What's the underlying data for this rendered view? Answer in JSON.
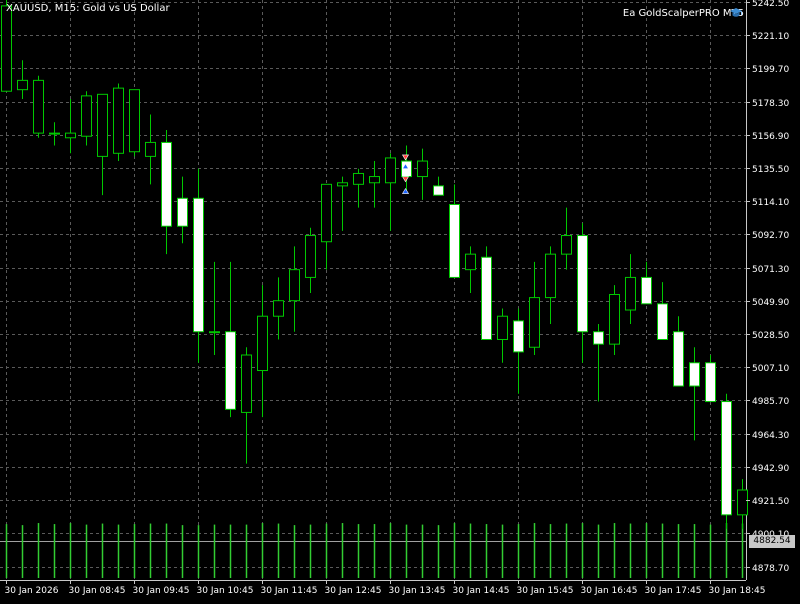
{
  "window": {
    "symbol_title": "XAUUSD, M15:  Gold vs US Dollar",
    "ea_name": "Ea GoldScalperPRO MT5",
    "ea_icon": "graduation-cap-icon"
  },
  "colors": {
    "background": "#000000",
    "grid": "#5a5a5a",
    "candle_outline": "#00c800",
    "bull_fill": "#000000",
    "bear_fill": "#ffffff",
    "volume": "#32cd32",
    "text": "#ffffff",
    "current_price_tag": "#c8c8c8"
  },
  "chart_data": {
    "type": "candlestick",
    "symbol": "XAUUSD",
    "timeframe": "M15",
    "y_ticks": [
      4878.7,
      4900.1,
      4921.5,
      4942.9,
      4964.3,
      4985.7,
      5007.1,
      5028.5,
      5049.9,
      5071.3,
      5092.7,
      5114.1,
      5135.5,
      5156.9,
      5178.3,
      5199.7,
      5221.1,
      5242.5
    ],
    "y_tick_labels": [
      "4878.70",
      "4900.10",
      "4921.50",
      "4942.90",
      "4964.30",
      "4985.70",
      "5007.10",
      "5028.50",
      "5049.90",
      "5071.30",
      "5092.70",
      "5114.10",
      "5135.50",
      "5156.90",
      "5178.30",
      "5199.70",
      "5221.10",
      "5242.50"
    ],
    "ylim": [
      4870,
      5242.5
    ],
    "x_tick_labels": [
      "30 Jan 2026",
      "30 Jan 08:45",
      "30 Jan 09:45",
      "30 Jan 10:45",
      "30 Jan 11:45",
      "30 Jan 12:45",
      "30 Jan 13:45",
      "30 Jan 14:45",
      "30 Jan 15:45",
      "30 Jan 16:45",
      "30 Jan 17:45",
      "30 Jan 18:45"
    ],
    "x_tick_every_n_bars": 4,
    "current_price": "4882.54",
    "grid": true,
    "candles": [
      {
        "o": 5185,
        "h": 5245,
        "l": 5185,
        "c": 5240
      },
      {
        "o": 5186,
        "h": 5205,
        "l": 5180,
        "c": 5192
      },
      {
        "o": 5158,
        "h": 5195,
        "l": 5155,
        "c": 5192
      },
      {
        "o": 5158,
        "h": 5165,
        "l": 5150,
        "c": 5158
      },
      {
        "o": 5155,
        "h": 5180,
        "l": 5145,
        "c": 5158
      },
      {
        "o": 5156,
        "h": 5185,
        "l": 5150,
        "c": 5182
      },
      {
        "o": 5143,
        "h": 5180,
        "l": 5118,
        "c": 5183
      },
      {
        "o": 5145,
        "h": 5190,
        "l": 5140,
        "c": 5187
      },
      {
        "o": 5146,
        "h": 5186,
        "l": 5143,
        "c": 5186
      },
      {
        "o": 5143,
        "h": 5170,
        "l": 5125,
        "c": 5152
      },
      {
        "o": 5152,
        "h": 5160,
        "l": 5080,
        "c": 5098
      },
      {
        "o": 5116,
        "h": 5130,
        "l": 5087,
        "c": 5098
      },
      {
        "o": 5116,
        "h": 5135,
        "l": 5010,
        "c": 5030
      },
      {
        "o": 5030,
        "h": 5075,
        "l": 5015,
        "c": 5030
      },
      {
        "o": 5030,
        "h": 5075,
        "l": 4975,
        "c": 4980
      },
      {
        "o": 4978,
        "h": 5020,
        "l": 4945,
        "c": 5015
      },
      {
        "o": 5005,
        "h": 5060,
        "l": 4975,
        "c": 5040
      },
      {
        "o": 5040,
        "h": 5065,
        "l": 5025,
        "c": 5050
      },
      {
        "o": 5050,
        "h": 5085,
        "l": 5030,
        "c": 5070
      },
      {
        "o": 5065,
        "h": 5097,
        "l": 5055,
        "c": 5092
      },
      {
        "o": 5088,
        "h": 5125,
        "l": 5070,
        "c": 5125
      },
      {
        "o": 5124,
        "h": 5130,
        "l": 5095,
        "c": 5126
      },
      {
        "o": 5125,
        "h": 5135,
        "l": 5110,
        "c": 5132
      },
      {
        "o": 5126,
        "h": 5140,
        "l": 5110,
        "c": 5130
      },
      {
        "o": 5126,
        "h": 5145,
        "l": 5095,
        "c": 5142
      },
      {
        "o": 5140,
        "h": 5150,
        "l": 5120,
        "c": 5130
      },
      {
        "o": 5130,
        "h": 5148,
        "l": 5115,
        "c": 5140
      },
      {
        "o": 5124,
        "h": 5130,
        "l": 5118,
        "c": 5118
      },
      {
        "o": 5112,
        "h": 5125,
        "l": 5065,
        "c": 5065
      },
      {
        "o": 5070,
        "h": 5085,
        "l": 5055,
        "c": 5080
      },
      {
        "o": 5078,
        "h": 5085,
        "l": 5025,
        "c": 5025
      },
      {
        "o": 5025,
        "h": 5045,
        "l": 5010,
        "c": 5040
      },
      {
        "o": 5037,
        "h": 5045,
        "l": 4990,
        "c": 5017
      },
      {
        "o": 5020,
        "h": 5075,
        "l": 5015,
        "c": 5052
      },
      {
        "o": 5052,
        "h": 5085,
        "l": 5035,
        "c": 5080
      },
      {
        "o": 5080,
        "h": 5110,
        "l": 5070,
        "c": 5092
      },
      {
        "o": 5092,
        "h": 5100,
        "l": 5010,
        "c": 5030
      },
      {
        "o": 5030,
        "h": 5035,
        "l": 4985,
        "c": 5022
      },
      {
        "o": 5022,
        "h": 5060,
        "l": 5015,
        "c": 5054
      },
      {
        "o": 5044,
        "h": 5080,
        "l": 5035,
        "c": 5065
      },
      {
        "o": 5065,
        "h": 5075,
        "l": 5048,
        "c": 5048
      },
      {
        "o": 5048,
        "h": 5062,
        "l": 5025,
        "c": 5025
      },
      {
        "o": 5030,
        "h": 5040,
        "l": 4995,
        "c": 4995
      },
      {
        "o": 5010,
        "h": 5020,
        "l": 4960,
        "c": 4995
      },
      {
        "o": 5010,
        "h": 5015,
        "l": 4985,
        "c": 4985
      },
      {
        "o": 4985,
        "h": 4990,
        "l": 4903,
        "c": 4912
      },
      {
        "o": 4912,
        "h": 4935,
        "l": 4903,
        "c": 4928
      }
    ],
    "volumes": [
      0.92,
      0.88,
      0.96,
      0.92,
      0.96,
      0.9,
      0.94,
      0.9,
      0.92,
      0.94,
      0.94,
      0.88,
      0.88,
      0.9,
      0.9,
      0.9,
      0.96,
      0.94,
      0.88,
      0.9,
      0.94,
      0.96,
      0.92,
      0.92,
      0.96,
      0.9,
      0.9,
      0.88,
      0.96,
      0.94,
      0.92,
      0.9,
      0.92,
      0.96,
      0.92,
      0.94,
      0.96,
      0.9,
      0.96,
      0.94,
      0.96,
      0.94,
      0.92,
      0.92,
      0.9,
      0.96,
      0.94
    ],
    "trade_markers": [
      {
        "bar": 25,
        "price": 5142,
        "kind": "sell",
        "color": "#ff3c3c"
      },
      {
        "bar": 25,
        "price": 5137,
        "kind": "buy",
        "color": "#1e64ff"
      },
      {
        "bar": 25,
        "price": 5128,
        "kind": "sell",
        "color": "#ff3c3c"
      },
      {
        "bar": 25,
        "price": 5121,
        "kind": "buy",
        "color": "#1e64ff"
      }
    ]
  }
}
